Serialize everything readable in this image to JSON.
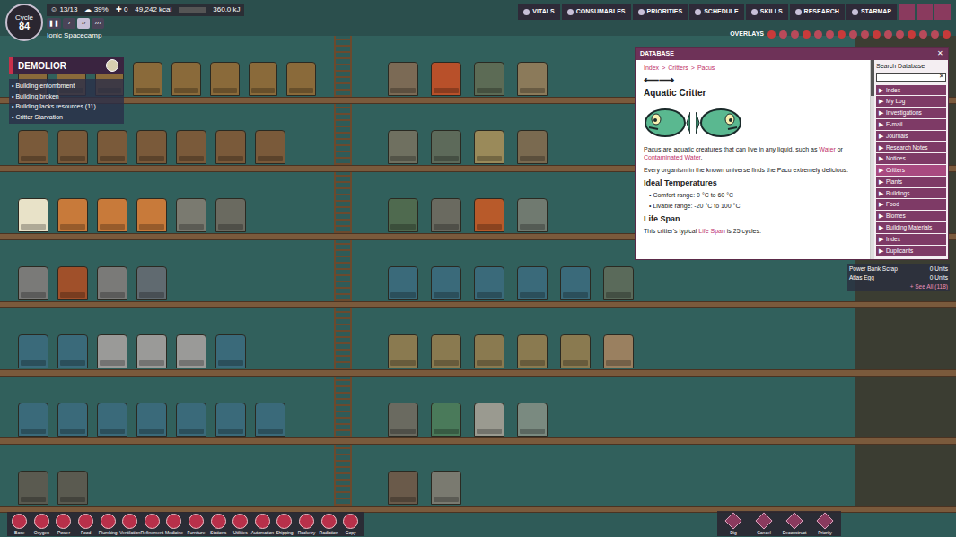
{
  "hud": {
    "cycle_label": "Cycle",
    "cycle": "84",
    "duplicants": "13/13",
    "stress": "39%",
    "sick": "0",
    "calories": "49,242 kcal",
    "power": "360.0 kJ",
    "colony": "Ionic Spacecamp"
  },
  "speed_buttons": [
    {
      "symbol": "❚❚",
      "selected": false
    },
    {
      "symbol": "›",
      "selected": false
    },
    {
      "symbol": "››",
      "selected": true
    },
    {
      "symbol": "›››",
      "selected": false
    }
  ],
  "top_menu": [
    {
      "label": "VITALS",
      "selected": false
    },
    {
      "label": "CONSUMABLES",
      "selected": false
    },
    {
      "label": "PRIORITIES",
      "selected": false
    },
    {
      "label": "SCHEDULE",
      "selected": false
    },
    {
      "label": "SKILLS",
      "selected": false
    },
    {
      "label": "RESEARCH",
      "selected": false
    },
    {
      "label": "STARMAP",
      "selected": false
    }
  ],
  "overlays_label": "OVERLAYS",
  "alert": {
    "name": "DEMOLIOR"
  },
  "notifications": [
    "Building entombment",
    "Building broken",
    "Building lacks resources (11)",
    "Critter Starvation"
  ],
  "database": {
    "title": "DATABASE",
    "close": "✕",
    "breadcrumb": [
      "Index",
      "Critters",
      "Pacus"
    ],
    "separator": ">",
    "nav": "⟵⟶",
    "heading": "Aquatic Critter",
    "description": [
      "Pacus are aquatic creatures that can live in any liquid, such as ",
      "Water",
      " or ",
      "Contaminated Water",
      "."
    ],
    "flavor": "Every organism in the known universe finds the Pacu extremely delicious.",
    "temp_heading": "Ideal Temperatures",
    "temps": [
      "Comfort range: 0 °C to 60 °C",
      "Livable range: -20 °C to 100 °C"
    ],
    "life_heading": "Life Span",
    "life_text": [
      "This critter's typical ",
      "Life Span",
      " is 25 cycles."
    ],
    "search_label": "Search Database",
    "search_clear": "✕",
    "sidebar": [
      {
        "label": "Index",
        "selected": false
      },
      {
        "label": "My Log",
        "selected": false
      },
      {
        "label": "Investigations",
        "selected": false
      },
      {
        "label": "E-mail",
        "selected": false
      },
      {
        "label": "Journals",
        "selected": false
      },
      {
        "label": "Research Notes",
        "selected": false
      },
      {
        "label": "Notices",
        "selected": false
      },
      {
        "label": "Critters",
        "selected": true
      },
      {
        "label": "Plants",
        "selected": false
      },
      {
        "label": "Buildings",
        "selected": false
      },
      {
        "label": "Food",
        "selected": false
      },
      {
        "label": "Biomes",
        "selected": false
      },
      {
        "label": "Building Materials",
        "selected": false
      },
      {
        "label": "Index",
        "selected": false
      },
      {
        "label": "Duplicants",
        "selected": false
      }
    ],
    "bullet": "▶"
  },
  "resources": [
    {
      "name": "Power Bank Scrap",
      "amount": "0 Units"
    },
    {
      "name": "Atlas Egg",
      "amount": "0 Units"
    }
  ],
  "see_all": "+ See All (118)",
  "build_menu": [
    "Base",
    "Oxygen",
    "Power",
    "Food",
    "Plumbing",
    "Ventilation",
    "Refinement",
    "Medicine",
    "Furniture",
    "Stations",
    "Utilities",
    "Automation",
    "Shipping",
    "Rocketry",
    "Radiation",
    "Copy"
  ],
  "tools": [
    "Dig",
    "Cancel",
    "Deconstruct",
    "Priority"
  ]
}
